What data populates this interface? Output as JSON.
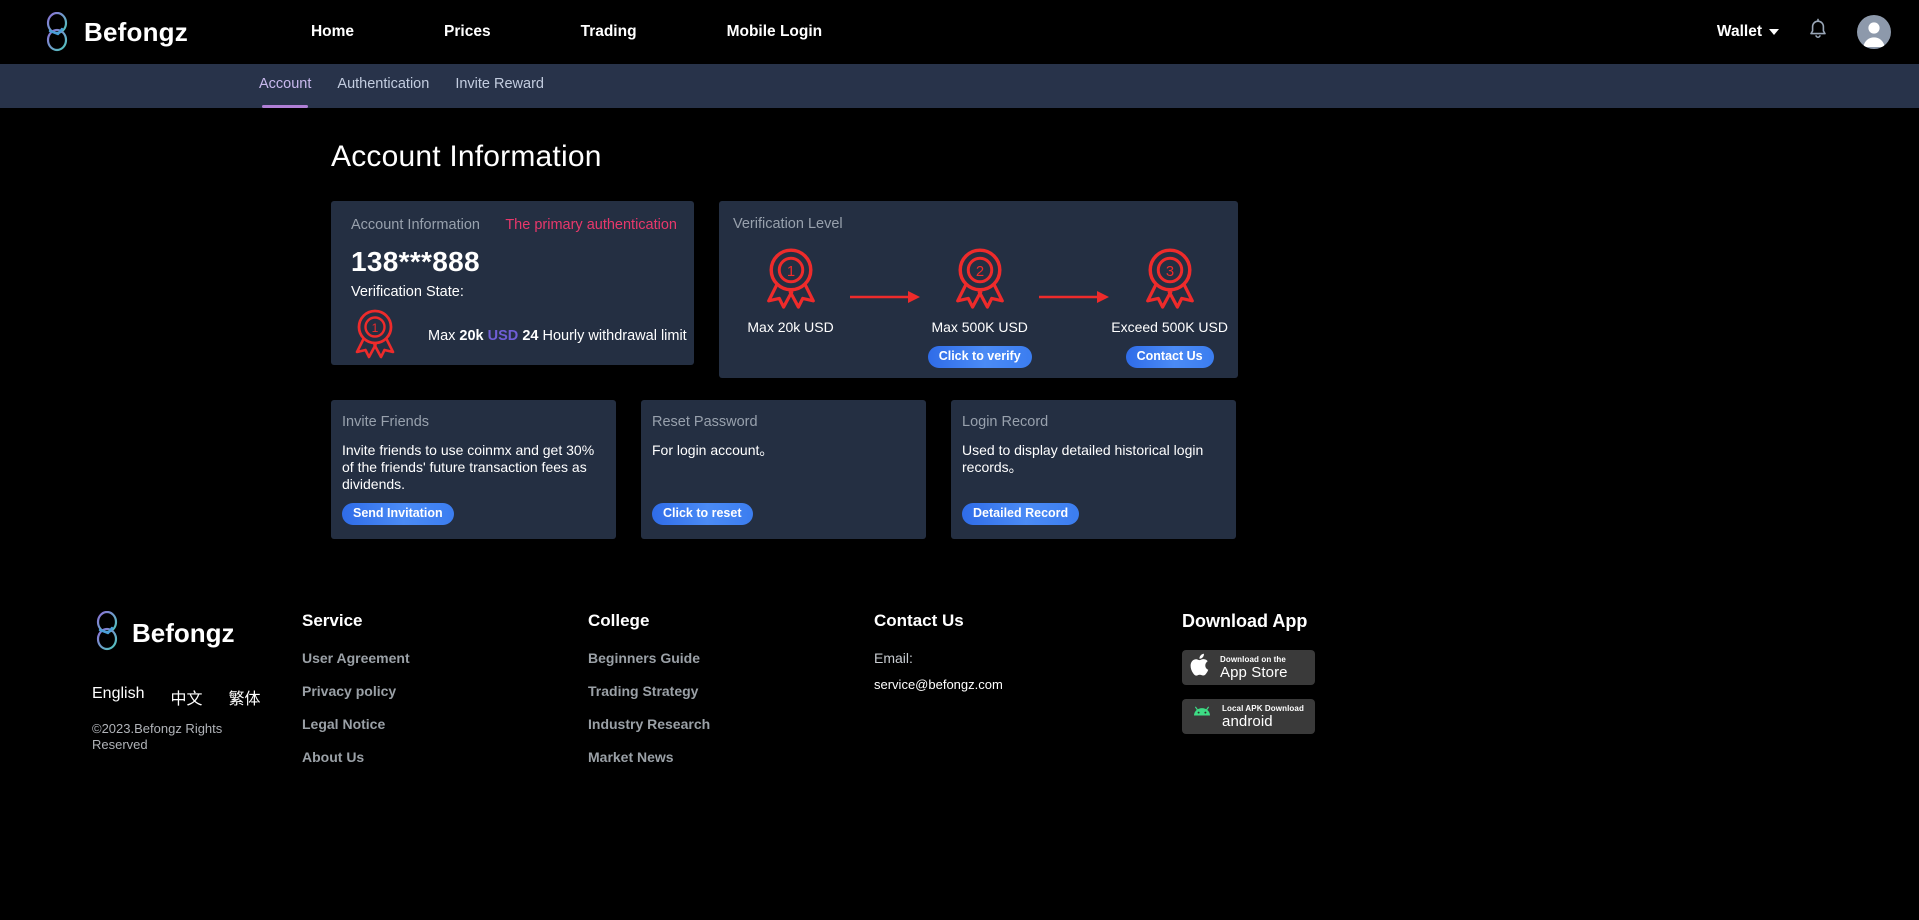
{
  "header": {
    "brand": "Befongz",
    "logo_icon": "befongz-b-logo",
    "nav": [
      {
        "label": "Home"
      },
      {
        "label": "Prices"
      },
      {
        "label": "Trading"
      },
      {
        "label": "Mobile Login"
      }
    ],
    "wallet_label": "Wallet",
    "wallet_caret_icon": "chevron-down-icon",
    "bell_icon": "notification-bell-icon",
    "avatar_icon": "user-avatar-icon"
  },
  "subnav": {
    "items": [
      {
        "label": "Account",
        "active": true
      },
      {
        "label": "Authentication",
        "active": false
      },
      {
        "label": "Invite Reward",
        "active": false
      }
    ]
  },
  "page": {
    "title": "Account Information"
  },
  "account_card": {
    "title": "Account Information",
    "status": "The primary authentication",
    "account_number": "138***888",
    "verification_state_label": "Verification State:",
    "badge_icon": "level-1-ribbon-icon",
    "limit_prefix": "Max ",
    "limit_amount": "20k",
    "limit_currency": "USD",
    "limit_hours": "24",
    "limit_suffix": " Hourly withdrawal limit"
  },
  "verification_card": {
    "title": "Verification Level",
    "levels": [
      {
        "badge_icon": "level-1-ribbon-icon",
        "label": "Max 20k USD",
        "button": null
      },
      {
        "badge_icon": "level-2-ribbon-icon",
        "label": "Max 500K USD",
        "button": "Click to verify"
      },
      {
        "badge_icon": "level-3-ribbon-icon",
        "label": "Exceed 500K USD",
        "button": "Contact Us"
      }
    ],
    "arrow_icon": "right-arrow-icon"
  },
  "mini_cards": [
    {
      "title": "Invite Friends",
      "description": "Invite friends to use coinmx and get 30% of the friends' future transaction fees as dividends.",
      "button": "Send Invitation"
    },
    {
      "title": "Reset Password",
      "description": "For login account。",
      "button": "Click to reset"
    },
    {
      "title": "Login Record",
      "description": "Used to display detailed historical login records。",
      "button": "Detailed Record"
    }
  ],
  "footer": {
    "brand": "Befongz",
    "logo_icon": "befongz-b-logo",
    "languages": [
      {
        "label": "English"
      },
      {
        "label": "中文"
      },
      {
        "label": "繁体"
      }
    ],
    "copyright": "©2023.Befongz Rights Reserved",
    "columns": [
      {
        "heading": "Service",
        "links": [
          {
            "label": "User Agreement"
          },
          {
            "label": "Privacy policy"
          },
          {
            "label": "Legal Notice"
          },
          {
            "label": "About Us"
          }
        ]
      },
      {
        "heading": "College",
        "links": [
          {
            "label": "Beginners Guide"
          },
          {
            "label": "Trading Strategy"
          },
          {
            "label": "Industry Research"
          },
          {
            "label": "Market News"
          }
        ]
      }
    ],
    "contact": {
      "heading": "Contact Us",
      "email_label": "Email:",
      "email": "service@befongz.com"
    },
    "download": {
      "heading": "Download App",
      "buttons": [
        {
          "top": "Download on the",
          "bottom": "App Store",
          "icon": "apple-logo-icon"
        },
        {
          "top": "Local APK Download",
          "bottom": "android",
          "icon": "android-robot-icon"
        }
      ]
    }
  },
  "colors": {
    "page_bg": "#000000",
    "card_bg": "#242f42",
    "subnav_bg": "#28334a",
    "accent_red": "#ee2b2b",
    "accent_pink": "#e8386b",
    "accent_blue": "#3b7df0",
    "accent_purple": "#b07fd6",
    "usd_purple": "#6f5ed6"
  }
}
